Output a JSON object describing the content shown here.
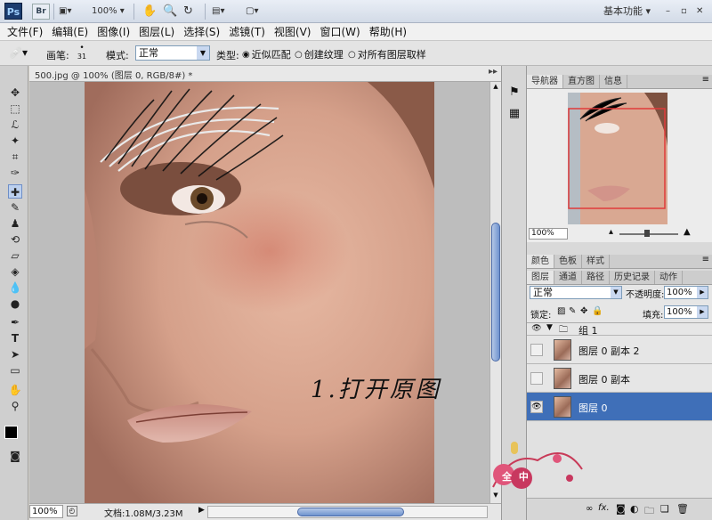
{
  "app": {
    "logo": "Ps",
    "bridge_label": "Br",
    "zoom": "100%",
    "workspace": "基本功能"
  },
  "window_controls": {
    "minimize": "–",
    "restore": "▫",
    "close": "✕"
  },
  "menu": [
    "文件(F)",
    "编辑(E)",
    "图像(I)",
    "图层(L)",
    "选择(S)",
    "滤镜(T)",
    "视图(V)",
    "窗口(W)",
    "帮助(H)"
  ],
  "options": {
    "brush_label": "画笔:",
    "brush_size": "31",
    "mode_label": "模式:",
    "mode_value": "正常",
    "type_label": "类型:",
    "type_options": [
      "近似匹配",
      "创建纹理"
    ],
    "sample_all_label": "对所有图层取样"
  },
  "document": {
    "tab_title": "500.jpg @ 100% (图层 0, RGB/8#) *",
    "overlay_text": "1.打开原图",
    "status_zoom": "100%",
    "status_doc": "文档:1.08M/3.23M"
  },
  "navigator": {
    "tabs": [
      "导航器",
      "直方图",
      "信息"
    ],
    "zoom": "100%"
  },
  "color_panel": {
    "tabs": [
      "颜色",
      "色板",
      "样式"
    ]
  },
  "layers_panel": {
    "tabs": [
      "图层",
      "通道",
      "路径",
      "历史记录",
      "动作"
    ],
    "blend_mode": "正常",
    "opacity_label": "不透明度:",
    "opacity": "100%",
    "lock_label": "锁定:",
    "fill_label": "填充:",
    "fill": "100%",
    "layers": [
      {
        "name": "组 1",
        "visible": true,
        "type": "group"
      },
      {
        "name": "图层 0 副本 2",
        "visible": false,
        "type": "layer"
      },
      {
        "name": "图层 0 副本",
        "visible": false,
        "type": "layer"
      },
      {
        "name": "图层 0",
        "visible": true,
        "type": "layer",
        "selected": true
      }
    ],
    "footer_fx": "fx."
  },
  "watermark": {
    "text": "全 中"
  },
  "colors": {
    "selected_layer": "#3f6fb8",
    "titlebar": "#dbe3ee"
  }
}
